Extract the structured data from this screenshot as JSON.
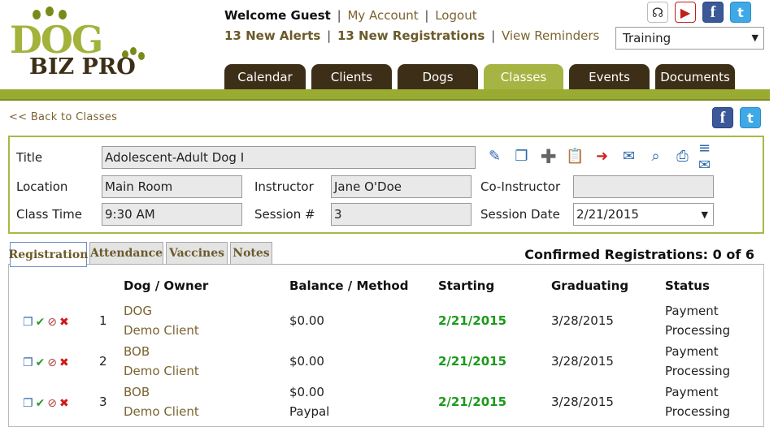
{
  "header": {
    "logo_top": "DOG",
    "logo_bottom": "BIZ PRO",
    "welcome": "Welcome Guest",
    "my_account": "My Account",
    "logout": "Logout",
    "alerts": "13 New Alerts",
    "registrations": "13 New Registrations",
    "reminders": "View Reminders",
    "separator": "|",
    "business_select": "Training",
    "icons": [
      "headset-icon",
      "video-icon",
      "facebook-icon",
      "twitter-icon"
    ]
  },
  "nav": {
    "tabs": [
      {
        "label": "Calendar",
        "active": false
      },
      {
        "label": "Clients",
        "active": false
      },
      {
        "label": "Dogs",
        "active": false
      },
      {
        "label": "Classes",
        "active": true
      },
      {
        "label": "Events",
        "active": false
      },
      {
        "label": "Documents",
        "active": false
      }
    ]
  },
  "back_link": "<< Back to Classes",
  "class_info": {
    "title_label": "Title",
    "title_value": "Adolescent-Adult Dog I",
    "location_label": "Location",
    "location_value": "Main Room",
    "instructor_label": "Instructor",
    "instructor_value": "Jane O'Doe",
    "coinstructor_label": "Co-Instructor",
    "coinstructor_value": "",
    "time_label": "Class Time",
    "time_value": "9:30 AM",
    "session_label": "Session #",
    "session_value": "3",
    "session_date_label": "Session Date",
    "session_date_value": "2/21/2015",
    "toolbar_icons": [
      "edit-icon",
      "copy-icon",
      "add-icon",
      "paste-icon",
      "redirect-icon",
      "email-icon",
      "search-doc-icon",
      "print-icon",
      "email-list-icon"
    ]
  },
  "subtabs": [
    {
      "label": "Registration",
      "active": true
    },
    {
      "label": "Attendance",
      "active": false
    },
    {
      "label": "Vaccines",
      "active": false
    },
    {
      "label": "Notes",
      "active": false
    }
  ],
  "confirmed": "Confirmed Registrations: 0 of 6",
  "table": {
    "headers": {
      "dog_owner": "Dog / Owner",
      "balance": "Balance / Method",
      "starting": "Starting",
      "graduating": "Graduating",
      "status": "Status"
    },
    "rows": [
      {
        "num": "1",
        "dog": "DOG",
        "owner": "Demo Client",
        "balance": "$0.00",
        "method": "",
        "starting": "2/21/2015",
        "graduating": "3/28/2015",
        "status1": "Payment",
        "status2": "Processing"
      },
      {
        "num": "2",
        "dog": "BOB",
        "owner": "Demo Client",
        "balance": "$0.00",
        "method": "",
        "starting": "2/21/2015",
        "graduating": "3/28/2015",
        "status1": "Payment",
        "status2": "Processing"
      },
      {
        "num": "3",
        "dog": "BOB",
        "owner": "Demo Client",
        "balance": "$0.00",
        "method": "Paypal",
        "starting": "2/21/2015",
        "graduating": "3/28/2015",
        "status1": "Payment",
        "status2": "Processing"
      }
    ]
  }
}
